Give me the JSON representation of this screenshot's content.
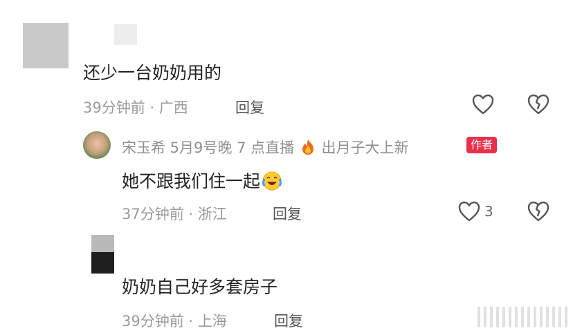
{
  "comments": [
    {
      "text": "还少一台奶奶用的",
      "time": "39分钟前 · 广西",
      "reply": "回复"
    },
    {
      "username": "宋玉希 5月9号晚 7 点直播",
      "username_suffix": "出月子大上新",
      "badge": "作者",
      "text": "她不跟我们住一起",
      "time": "37分钟前 · 浙江",
      "reply": "回复",
      "likes": "3"
    },
    {
      "text": "奶奶自己好多套房子",
      "time": "39分钟前 · 上海",
      "reply": "回复"
    }
  ],
  "icons": {
    "like": "heart-outline-icon",
    "dislike": "broken-heart-icon",
    "fire": "fire-emoji",
    "laugh": "laugh-crying-emoji"
  },
  "colors": {
    "badge": "#ea2f4b",
    "meta": "#9a9a9a",
    "text": "#222222"
  }
}
